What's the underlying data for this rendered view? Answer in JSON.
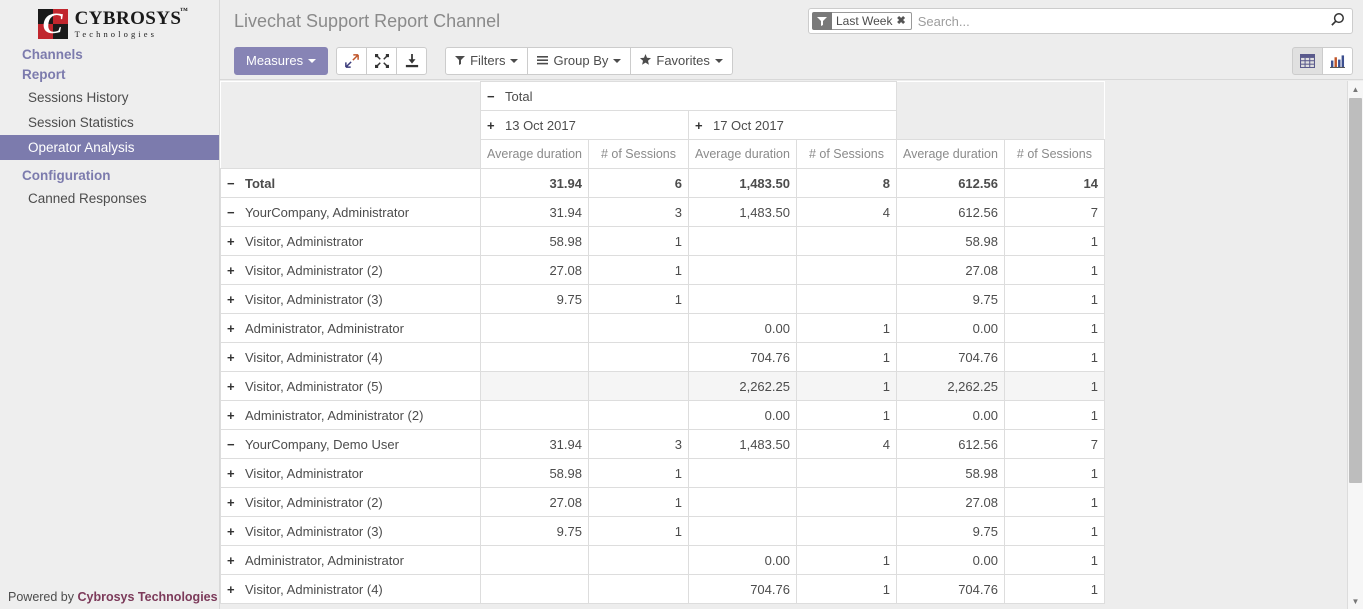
{
  "brand": {
    "name": "CYBROSYS",
    "tm": "™",
    "tagline": "Technologies",
    "mark_letter": "C",
    "colors": {
      "red": "#c1262d",
      "black": "#1a1a1a"
    }
  },
  "sidebar": {
    "sections": [
      {
        "label": "Channels",
        "type": "section"
      },
      {
        "label": "Report",
        "type": "section"
      },
      {
        "label": "Sessions History",
        "type": "item",
        "active": false
      },
      {
        "label": "Session Statistics",
        "type": "item",
        "active": false
      },
      {
        "label": "Operator Analysis",
        "type": "item",
        "active": true
      },
      {
        "label": "Configuration",
        "type": "section"
      },
      {
        "label": "Canned Responses",
        "type": "item",
        "active": false
      }
    ],
    "active_color": "#7c7bad"
  },
  "footer": {
    "prefix": "Powered by ",
    "brand": "Cybrosys Technologies"
  },
  "header": {
    "title": "Livechat Support Report Channel"
  },
  "search": {
    "facet": {
      "icon": "filter-icon",
      "label": "Last Week",
      "remove": "✖"
    },
    "placeholder": "Search...",
    "value": "",
    "search_icon": "search-icon"
  },
  "toolbar": {
    "measures_label": "Measures",
    "expand_icon": "expand-arrows-icon",
    "fullscreen_icon": "fullscreen-icon",
    "download_icon": "download-icon",
    "filters_label": "Filters",
    "groupby_label": "Group By",
    "favorites_label": "Favorites",
    "filters_icon": "funnel-icon",
    "groupby_icon": "bars-icon",
    "favorites_icon": "star-icon",
    "view_list_icon": "table-view-icon",
    "view_chart_icon": "bar-chart-icon",
    "active_view": "table"
  },
  "pivot": {
    "col_root": {
      "label": "Total",
      "toggle": "−"
    },
    "col_groups": [
      {
        "label": "13 Oct 2017",
        "toggle": "+"
      },
      {
        "label": "17 Oct 2017",
        "toggle": "+"
      }
    ],
    "measures": [
      "Average duration",
      "# of Sessions"
    ],
    "total_group_label": "Total",
    "rows": [
      {
        "label": "Total",
        "toggle": "−",
        "indent": 0,
        "level": 0,
        "cells": [
          "31.94",
          "6",
          "1,483.50",
          "8",
          "612.56",
          "14"
        ]
      },
      {
        "label": "YourCompany, Administrator",
        "toggle": "−",
        "indent": 1,
        "level": 1,
        "cells": [
          "31.94",
          "3",
          "1,483.50",
          "4",
          "612.56",
          "7"
        ]
      },
      {
        "label": "Visitor, Administrator",
        "toggle": "+",
        "indent": 2,
        "level": 2,
        "cells": [
          "58.98",
          "1",
          "",
          "",
          "58.98",
          "1"
        ]
      },
      {
        "label": "Visitor, Administrator (2)",
        "toggle": "+",
        "indent": 2,
        "level": 2,
        "cells": [
          "27.08",
          "1",
          "",
          "",
          "27.08",
          "1"
        ]
      },
      {
        "label": "Visitor, Administrator (3)",
        "toggle": "+",
        "indent": 2,
        "level": 2,
        "cells": [
          "9.75",
          "1",
          "",
          "",
          "9.75",
          "1"
        ]
      },
      {
        "label": "Administrator, Administrator",
        "toggle": "+",
        "indent": 2,
        "level": 2,
        "cells": [
          "",
          "",
          "0.00",
          "1",
          "0.00",
          "1"
        ]
      },
      {
        "label": "Visitor, Administrator (4)",
        "toggle": "+",
        "indent": 2,
        "level": 2,
        "cells": [
          "",
          "",
          "704.76",
          "1",
          "704.76",
          "1"
        ]
      },
      {
        "label": "Visitor, Administrator (5)",
        "toggle": "+",
        "indent": 2,
        "level": 2,
        "hovered": true,
        "cells": [
          "",
          "",
          "2,262.25",
          "1",
          "2,262.25",
          "1"
        ]
      },
      {
        "label": "Administrator, Administrator (2)",
        "toggle": "+",
        "indent": 2,
        "level": 2,
        "cells": [
          "",
          "",
          "0.00",
          "1",
          "0.00",
          "1"
        ]
      },
      {
        "label": "YourCompany, Demo User",
        "toggle": "−",
        "indent": 1,
        "level": 1,
        "cells": [
          "31.94",
          "3",
          "1,483.50",
          "4",
          "612.56",
          "7"
        ]
      },
      {
        "label": "Visitor, Administrator",
        "toggle": "+",
        "indent": 2,
        "level": 2,
        "cells": [
          "58.98",
          "1",
          "",
          "",
          "58.98",
          "1"
        ]
      },
      {
        "label": "Visitor, Administrator (2)",
        "toggle": "+",
        "indent": 2,
        "level": 2,
        "cells": [
          "27.08",
          "1",
          "",
          "",
          "27.08",
          "1"
        ]
      },
      {
        "label": "Visitor, Administrator (3)",
        "toggle": "+",
        "indent": 2,
        "level": 2,
        "cells": [
          "9.75",
          "1",
          "",
          "",
          "9.75",
          "1"
        ]
      },
      {
        "label": "Administrator, Administrator",
        "toggle": "+",
        "indent": 2,
        "level": 2,
        "cells": [
          "",
          "",
          "0.00",
          "1",
          "0.00",
          "1"
        ]
      },
      {
        "label": "Visitor, Administrator (4)",
        "toggle": "+",
        "indent": 2,
        "level": 2,
        "cells": [
          "",
          "",
          "704.76",
          "1",
          "704.76",
          "1"
        ]
      }
    ]
  },
  "scrollbar": {
    "up": "▲",
    "down": "▼"
  }
}
